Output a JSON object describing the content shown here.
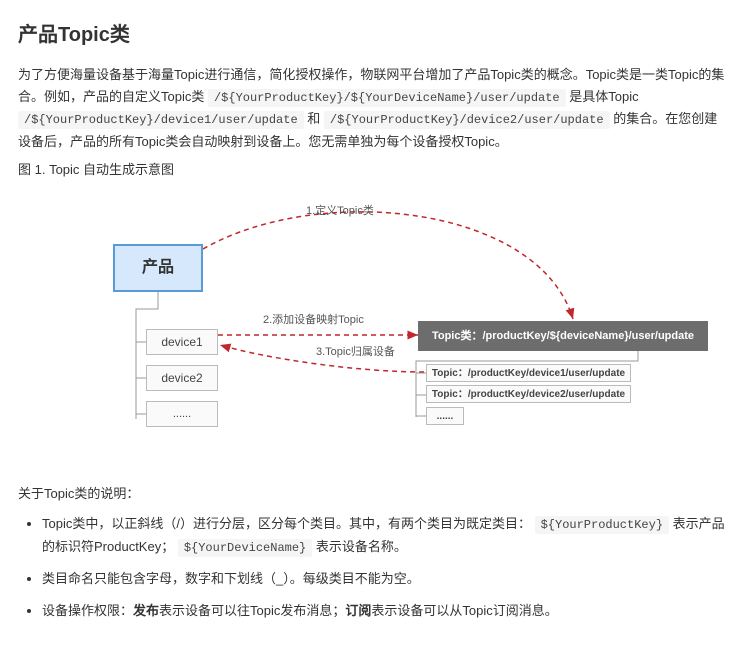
{
  "title": "产品Topic类",
  "intro": {
    "part1": "为了方便海量设备基于海量Topic进行通信，简化授权操作，物联网平台增加了产品Topic类的概念。Topic类是一类Topic的集合。例如，产品的自定义Topic类 ",
    "code1": "/${YourProductKey}/${YourDeviceName}/user/update",
    "part2": " 是具体Topic ",
    "code2": "/${YourProductKey}/device1/user/update",
    "part3": " 和 ",
    "code3": "/${YourProductKey}/device2/user/update",
    "part4": " 的集合。在您创建设备后，产品的所有Topic类会自动映射到设备上。您无需单独为每个设备授权Topic。"
  },
  "figure_caption": "图 1. Topic 自动生成示意图",
  "diagram": {
    "product": "产品",
    "device1": "device1",
    "device2": "device2",
    "device_more": "......",
    "topic_class": "Topic类：/productKey/${deviceName}/user/update",
    "topic_inst1": "Topic：/productKey/device1/user/update",
    "topic_inst2": "Topic：/productKey/device2/user/update",
    "topic_inst_more": "......",
    "label1": "1.定义Topic类",
    "label2": "2.添加设备映射Topic",
    "label3": "3.Topic归属设备"
  },
  "notes_intro": "关于Topic类的说明：",
  "notes": {
    "n1a": "Topic类中，以正斜线（/）进行分层，区分每个类目。其中，有两个类目为既定类目：",
    "n1code1": "${YourProductKey}",
    "n1b": " 表示产品的标识符ProductKey；",
    "n1code2": "${YourDeviceName}",
    "n1c": " 表示设备名称。",
    "n2": "类目命名只能包含字母，数字和下划线（_）。每级类目不能为空。",
    "n3a": "设备操作权限：",
    "n3b": "发布",
    "n3c": "表示设备可以往Topic发布消息；",
    "n3d": "订阅",
    "n3e": "表示设备可以从Topic订阅消息。"
  }
}
